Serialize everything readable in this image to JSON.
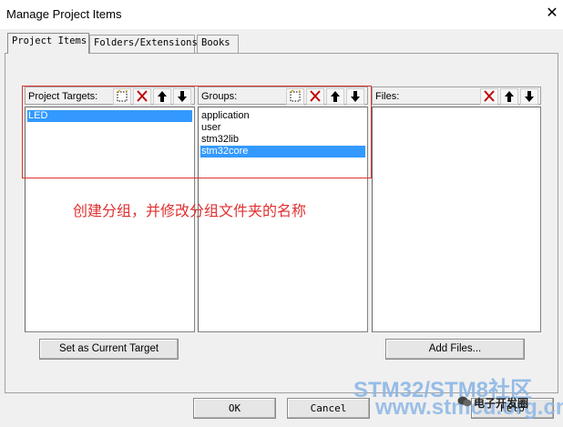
{
  "window": {
    "title": "Manage Project Items",
    "close_glyph": "✕"
  },
  "tabs": [
    {
      "label": "Project Items",
      "active": true
    },
    {
      "label": "Folders/Extensions",
      "active": false
    },
    {
      "label": "Books",
      "active": false
    }
  ],
  "targets": {
    "label": "Project Targets:",
    "items": [
      "LED"
    ],
    "selected": 0
  },
  "groups": {
    "label": "Groups:",
    "items": [
      "application",
      "user",
      "stm32lib",
      "stm32core"
    ],
    "selected": 3
  },
  "files": {
    "label": "Files:",
    "items": []
  },
  "buttons": {
    "set_current": "Set as Current Target",
    "add_files": "Add Files...",
    "ok": "OK",
    "cancel": "Cancel",
    "help": "Help"
  },
  "annotation": "创建分组，并修改分组文件夹的名称",
  "watermark": {
    "line1": "STM32/STM8社区",
    "line2": "www.stmcu.org.cn",
    "line3": "电子开发圈"
  },
  "icons": {
    "new": "new-item-icon",
    "delete": "delete-icon",
    "up": "move-up-icon",
    "down": "move-down-icon"
  },
  "colors": {
    "selection": "#3399ff",
    "annotation": "#e03030",
    "watermark": "#8db7e6"
  }
}
